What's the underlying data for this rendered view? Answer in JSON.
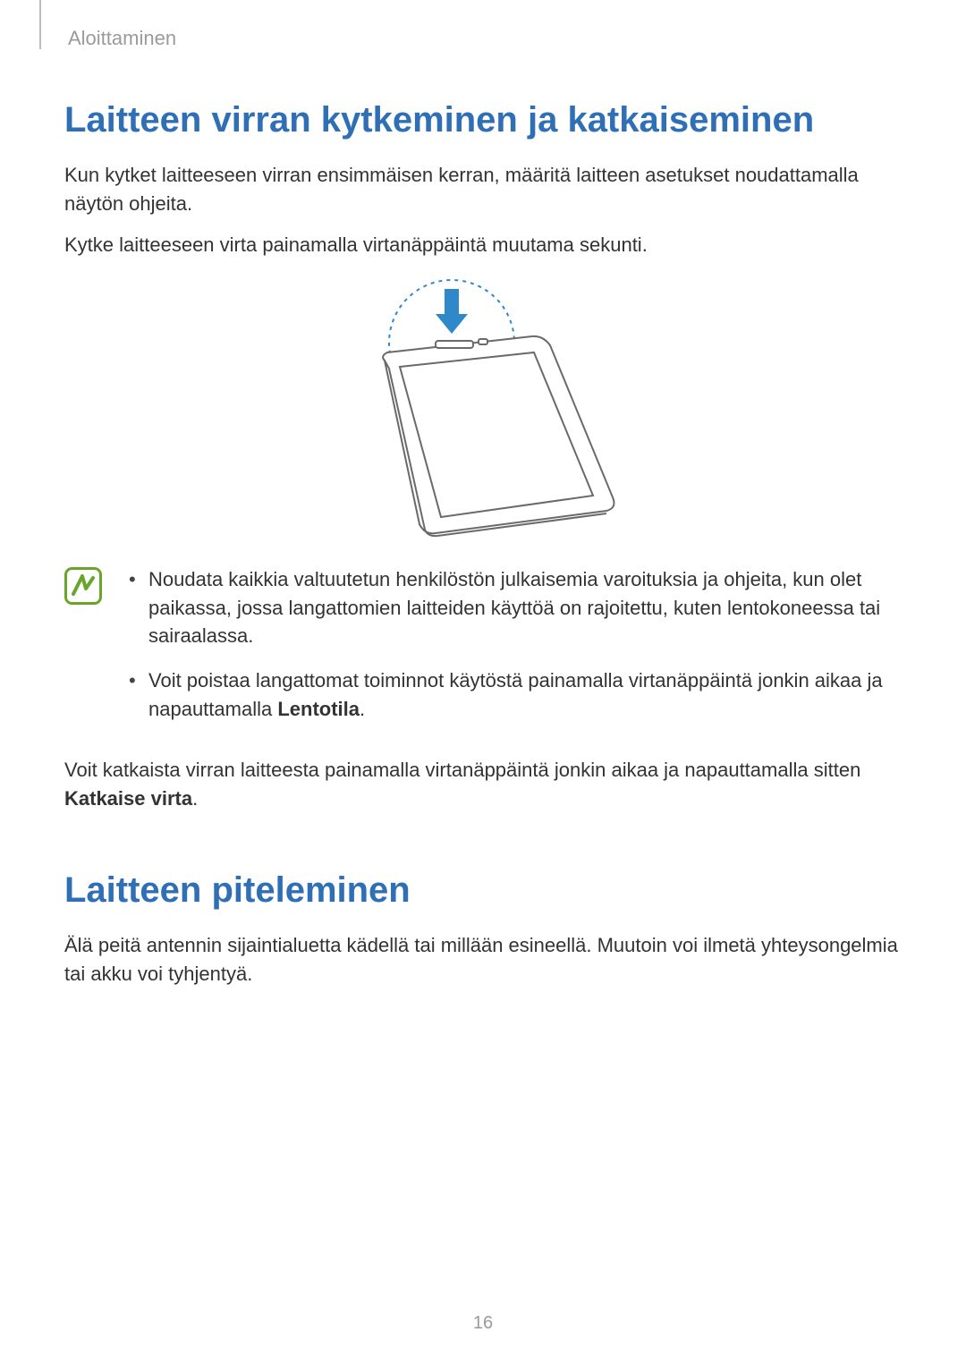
{
  "breadcrumb": "Aloittaminen",
  "section1": {
    "title": "Laitteen virran kytkeminen ja katkaiseminen",
    "p1": "Kun kytket laitteeseen virran ensimmäisen kerran, määritä laitteen asetukset noudattamalla näytön ohjeita.",
    "p2": "Kytke laitteeseen virta painamalla virtanäppäintä muutama sekunti."
  },
  "note": {
    "bullet1": "Noudata kaikkia valtuutetun henkilöstön julkaisemia varoituksia ja ohjeita, kun olet paikassa, jossa langattomien laitteiden käyttöä on rajoitettu, kuten lentokoneessa tai sairaalassa.",
    "bullet2_a": "Voit poistaa langattomat toiminnot käytöstä painamalla virtanäppäintä jonkin aikaa ja napauttamalla ",
    "bullet2_b": "Lentotila",
    "bullet2_c": "."
  },
  "section1_p3_a": "Voit katkaista virran laitteesta painamalla virtanäppäintä jonkin aikaa ja napauttamalla sitten ",
  "section1_p3_b": "Katkaise virta",
  "section1_p3_c": ".",
  "section2": {
    "title": "Laitteen piteleminen",
    "p1": "Älä peitä antennin sijaintialuetta kädellä tai millään esineellä. Muutoin voi ilmetä yhteysongelmia tai akku voi tyhjentyä."
  },
  "page_number": "16"
}
